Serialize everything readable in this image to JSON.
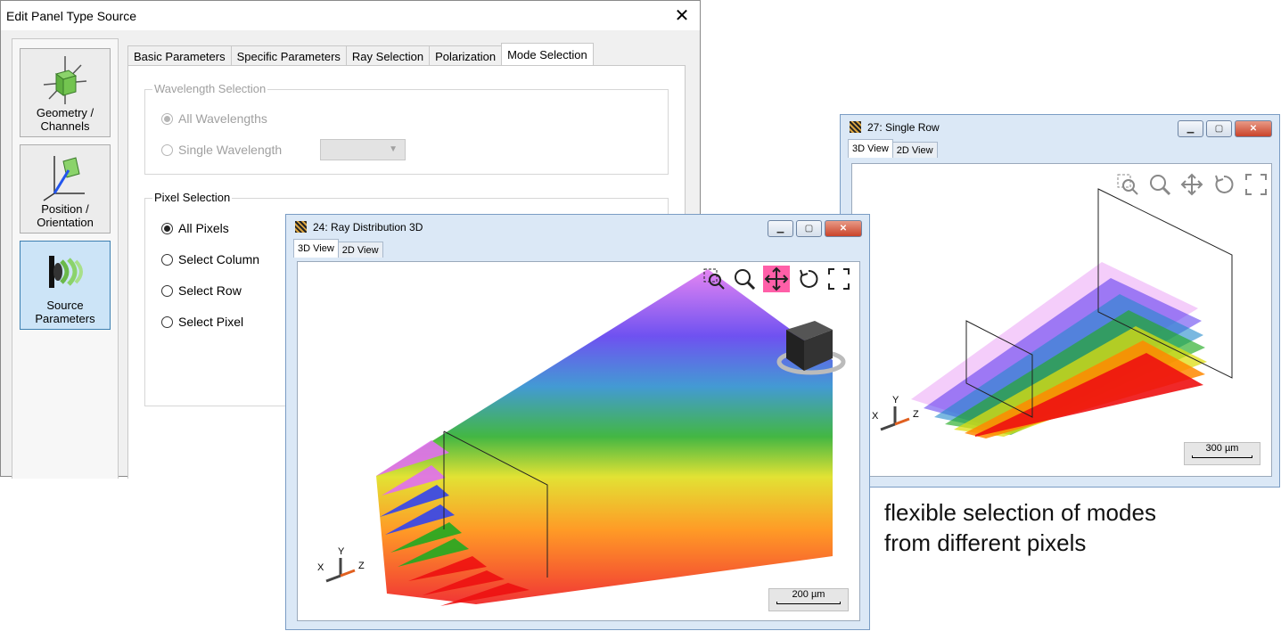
{
  "dialog": {
    "title": "Edit Panel Type Source",
    "sidebar": [
      {
        "label_line1": "Geometry /",
        "label_line2": "Channels",
        "icon": "geometry-cube-icon"
      },
      {
        "label_line1": "Position /",
        "label_line2": "Orientation",
        "icon": "position-axes-icon"
      },
      {
        "label_line1": "Source",
        "label_line2": "Parameters",
        "icon": "source-beam-icon"
      }
    ],
    "tabs": [
      "Basic Parameters",
      "Specific Parameters",
      "Ray Selection",
      "Polarization",
      "Mode Selection"
    ],
    "wavelength_group": {
      "title": "Wavelength Selection",
      "all": "All Wavelengths",
      "single": "Single Wavelength"
    },
    "pixel_group": {
      "title": "Pixel Selection",
      "options": [
        "All Pixels",
        "Select Column",
        "Select Row",
        "Select Pixel"
      ]
    }
  },
  "window_a": {
    "title": "24: Ray Distribution 3D",
    "tabs": [
      "3D View",
      "2D View"
    ],
    "axes": {
      "x": "X",
      "y": "Y",
      "z": "Z"
    },
    "scale": "200 µm"
  },
  "window_b": {
    "title": "27: Single Row",
    "tabs": [
      "3D View",
      "2D View"
    ],
    "axes": {
      "x": "X",
      "y": "Y",
      "z": "Z"
    },
    "scale": "300 µm"
  },
  "caption": {
    "line1": "flexible selection of modes",
    "line2": "from different pixels"
  },
  "colors": {
    "accent": "#3c7fb1",
    "pan_active": "#ff5fa8",
    "ray_violet": "#e070f0",
    "ray_blue": "#3344ee",
    "ray_green": "#22aa22",
    "ray_yellow": "#dddd10",
    "ray_orange": "#ff8800",
    "ray_red": "#ee1111"
  }
}
